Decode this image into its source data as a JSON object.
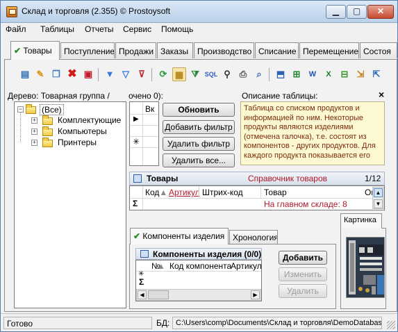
{
  "window": {
    "title": "Склад и торговля (2.355) © Prostoysoft",
    "min_glyph": "▁",
    "max_glyph": "▢",
    "close_glyph": "✕"
  },
  "menu": [
    "Файл",
    "Таблицы",
    "Отчеты",
    "Сервис",
    "Помощь"
  ],
  "tabs": {
    "check_glyph": "✔",
    "items": [
      "Товары",
      "Поступление",
      "Продажи",
      "Заказы",
      "Производство",
      "Списание",
      "Перемещение",
      "Состоя"
    ],
    "active": "Товары"
  },
  "toolbar_icons": [
    "new-icon",
    "edit-icon",
    "copy-icon",
    "delete-icon",
    "delete-all-icon",
    "filter-icon",
    "filter-clear-icon",
    "filter-remove-icon",
    "refresh-icon",
    "group-icon",
    "auto-filter-icon",
    "sql-icon",
    "find-icon",
    "print-icon",
    "preview-icon",
    "export-icon",
    "export-excel-icon",
    "export-word-icon",
    "export-excel2-icon",
    "export-csv-icon",
    "import-icon",
    "export-xml-icon"
  ],
  "tree": {
    "header": "Дерево: Товарная группа /",
    "root": "(Все)",
    "items": [
      "Комплектующие",
      "Компьютеры",
      "Принтеры"
    ]
  },
  "filter": {
    "header": "очено 0):",
    "column_header": "Вк",
    "asterisk": "✳",
    "row_arrow": "▶",
    "buttons": {
      "refresh": "Обновить",
      "add_filter": "Добавить фильтр",
      "remove_filter": "Удалить фильтр",
      "remove_all": "Удалить все..."
    }
  },
  "description": {
    "header": "Описание таблицы:",
    "close": "×",
    "text": "Таблица со списком продуктов и информацией по ним. Некоторые продукты являются изделиями (отмечена галочка), т.е. состоят из компонентов - других продуктов. Для каждого продукта показывается его"
  },
  "goods": {
    "title": "Товары",
    "subtitle": "Справочник товаров",
    "counter": "1/12",
    "columns": [
      "Код",
      "Артикул",
      "Штрих-код",
      "Товар",
      "Ог"
    ],
    "sum_glyph": "Σ",
    "footer_text": "На главном складе: 8"
  },
  "subtabs": {
    "items": [
      "Компоненты изделия",
      "Хронология"
    ],
    "active": "Компоненты изделия",
    "picture_tab": "Картинка"
  },
  "components": {
    "title": "Компоненты изделия (0/0)",
    "columns": [
      "№",
      "Код компонента",
      "Артикул"
    ],
    "asterisk": "✳",
    "sum_glyph": "Σ",
    "buttons": {
      "add": "Добавить",
      "edit": "Изменить",
      "delete": "Удалить"
    }
  },
  "status": {
    "left": "Готово",
    "db_label": "БД:",
    "db_path": "C:\\Users\\comp\\Documents\\Склад и торговля\\DemoDatabase"
  },
  "colors": {
    "accent_red": "#b0182a",
    "description_bg": "#fbf8d2",
    "description_text": "#7b2c0c",
    "check_green": "#2a8a2a"
  }
}
